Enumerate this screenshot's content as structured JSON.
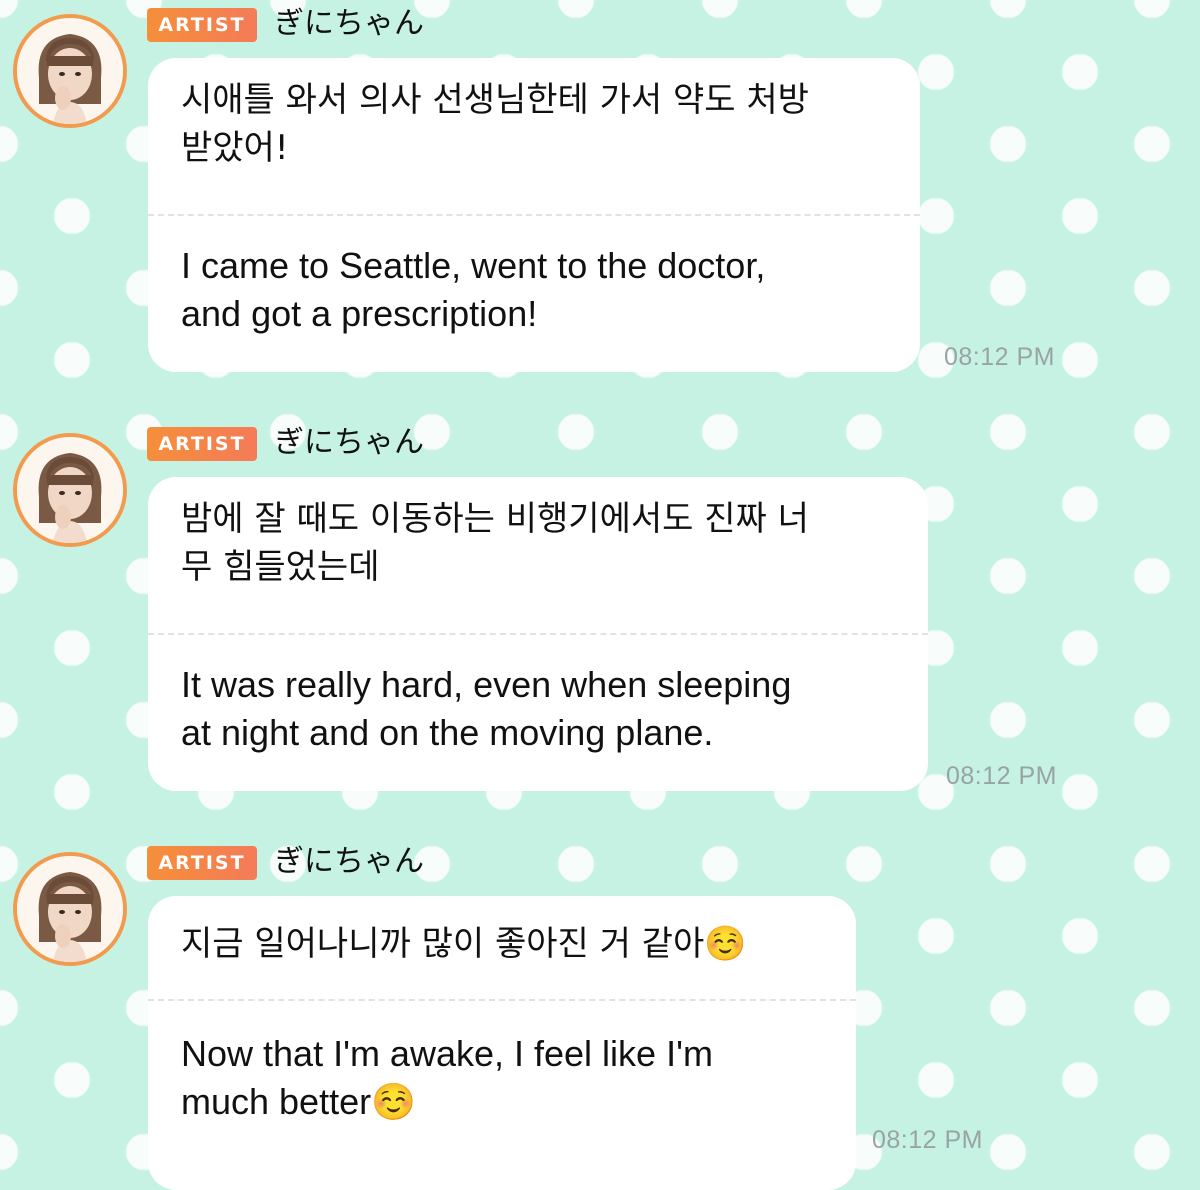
{
  "colors": {
    "background": "#c6f2e3",
    "dots": "#ffffff",
    "badge_start": "#f58f3a",
    "badge_end": "#f47b58",
    "avatar_ring": "#f29a4d",
    "bubble": "#ffffff",
    "timestamp": "#9aa3a4"
  },
  "messages": [
    {
      "badge": "ARTIST",
      "username": "ぎにちゃん",
      "avatar_icon": "profile-photo",
      "korean": "시애틀 와서 의사 선생님한테 가서 약도 처방\n받았어!",
      "english": "I came to Seattle, went to the doctor,\nand got a prescription!",
      "time": "08:12 PM"
    },
    {
      "badge": "ARTIST",
      "username": "ぎにちゃん",
      "avatar_icon": "profile-photo",
      "korean": "밤에 잘 때도 이동하는 비행기에서도 진짜 너\n무 힘들었는데",
      "english": "It was really hard, even when sleeping\nat night and on the moving plane.",
      "time": "08:12 PM"
    },
    {
      "badge": "ARTIST",
      "username": "ぎにちゃん",
      "avatar_icon": "profile-photo",
      "korean": "지금 일어나니까 많이 좋아진 거 같아☺️",
      "english": "Now that I'm awake, I feel like I'm\nmuch better☺️",
      "time": "08:12 PM"
    }
  ]
}
